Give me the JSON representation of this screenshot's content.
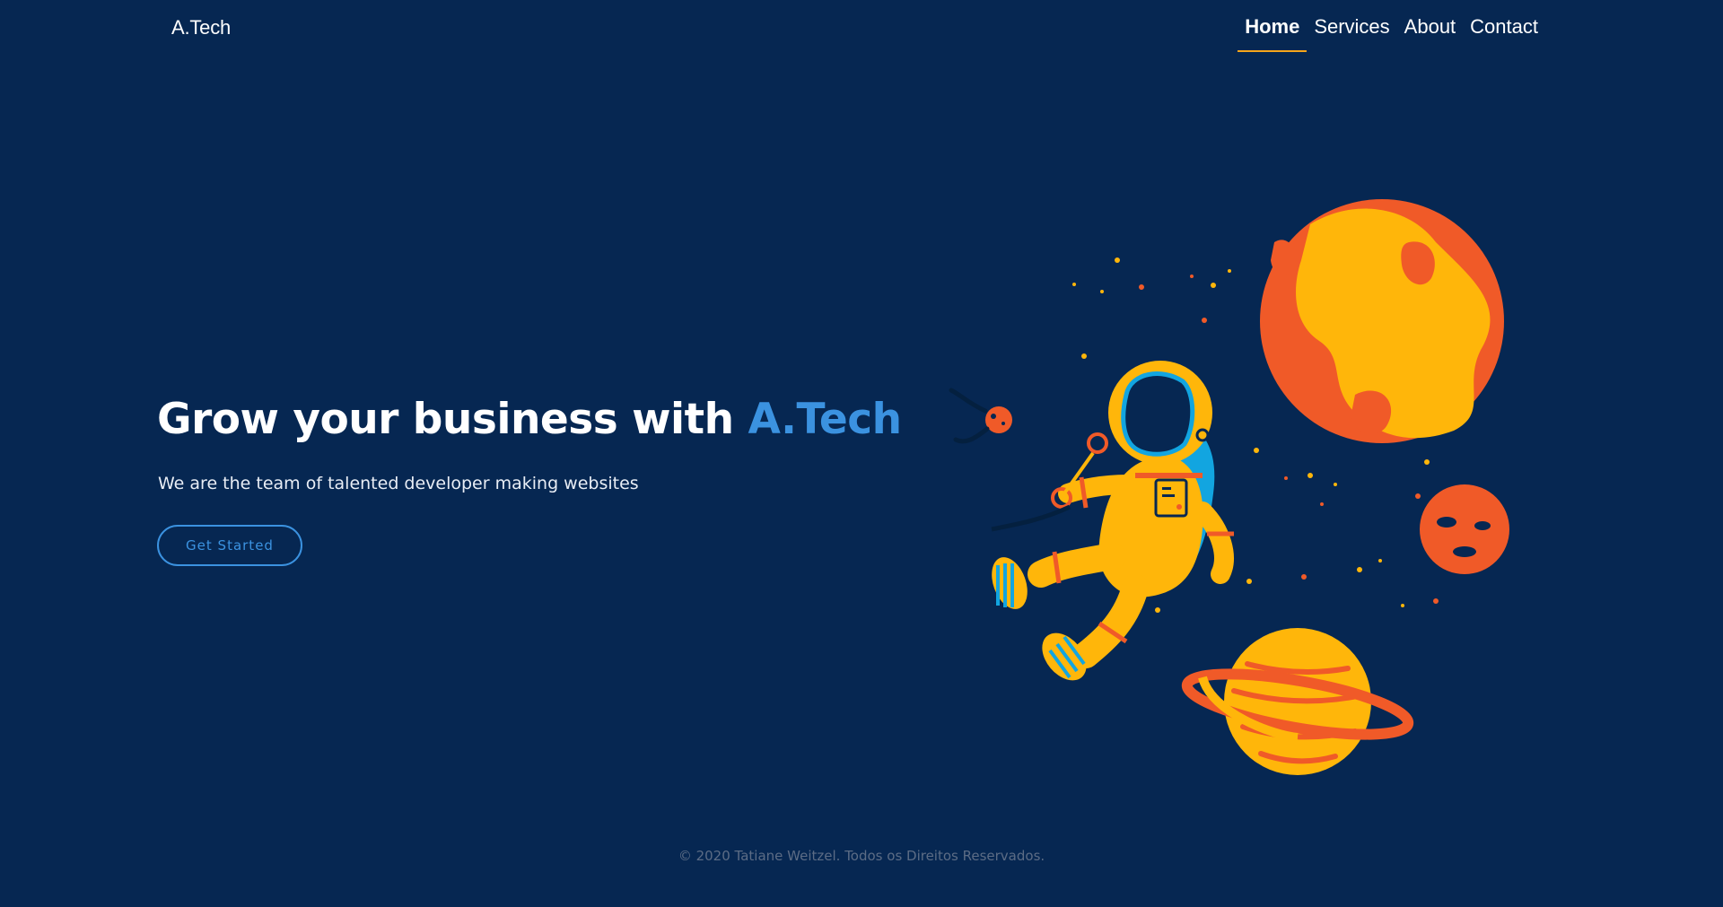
{
  "brand": "A.Tech",
  "nav": {
    "items": [
      {
        "label": "Home",
        "active": true
      },
      {
        "label": "Services",
        "active": false
      },
      {
        "label": "About",
        "active": false
      },
      {
        "label": "Contact",
        "active": false
      }
    ]
  },
  "hero": {
    "title_prefix": "Grow your business with",
    "title_accent": "A.Tech",
    "subtitle": "We are the team of talented developer making websites",
    "cta_label": "Get Started"
  },
  "illustration": {
    "icon": "astronaut-planets-illustration"
  },
  "footer": {
    "copyright": "© 2020 Tatiane Weitzel. Todos os Direitos Reservados."
  },
  "colors": {
    "background": "#062752",
    "accent_blue": "#3b92e0",
    "nav_underline": "#f5a51b",
    "planet_orange": "#f05a28",
    "planet_yellow": "#ffb60a",
    "footer_text": "#5c6c85"
  }
}
